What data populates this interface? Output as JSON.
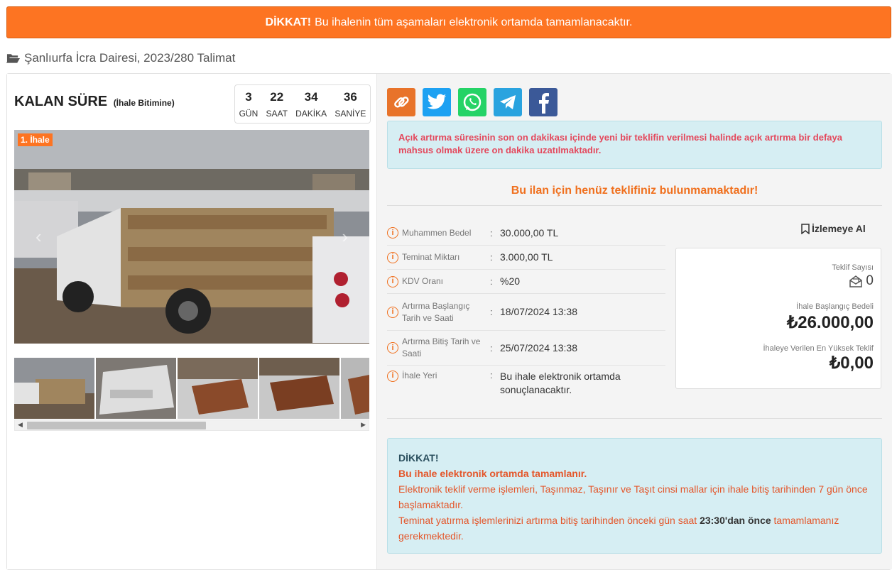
{
  "banner": {
    "strong": "DİKKAT!",
    "text": "Bu ihalenin tüm aşamaları elektronik ortamda tamamlanacaktır."
  },
  "breadcrumb": {
    "icon": "folder-open-icon",
    "text": "Şanlıurfa İcra Dairesi, 2023/280 Talimat"
  },
  "countdown": {
    "title": "KALAN SÜRE",
    "subtitle": "(İhale Bitimine)",
    "days": "3",
    "days_label": "GÜN",
    "hours": "22",
    "hours_label": "SAAT",
    "minutes": "34",
    "minutes_label": "DAKİKA",
    "seconds": "36",
    "seconds_label": "SANİYE"
  },
  "gallery": {
    "badge": "1. İhale",
    "thumb_count": 5
  },
  "share": {
    "icons": [
      "link-icon",
      "twitter-icon",
      "whatsapp-icon",
      "telegram-icon",
      "facebook-icon"
    ],
    "colors": {
      "link": "#e8732a",
      "twitter": "#1da1f2",
      "whatsapp": "#25d366",
      "telegram": "#2aa3df",
      "facebook": "#3b5998"
    }
  },
  "alert": {
    "text": "Açık artırma süresinin son on dakikası içinde yeni bir teklifin verilmesi halinde açık artırma bir defaya mahsus olmak üzere on dakika uzatılmaktadır."
  },
  "no_bid": "Bu ilan için henüz teklifiniz bulunmamaktadır!",
  "details": [
    {
      "label": "Muhammen Bedel",
      "value": "30.000,00 TL"
    },
    {
      "label": "Teminat Miktarı",
      "value": "3.000,00 TL"
    },
    {
      "label": "KDV Oranı",
      "value": "%20"
    },
    {
      "label": "Artırma Başlangıç Tarih ve Saati",
      "value": "18/07/2024 13:38"
    },
    {
      "label": "Artırma Bitiş Tarih ve Saati",
      "value": "25/07/2024 13:38"
    },
    {
      "label": "İhale Yeri",
      "value": "Bu ihale elektronik ortamda sonuçlanacaktır."
    }
  ],
  "watch": {
    "label": "İzlemeye Al"
  },
  "summary": {
    "bid_count_label": "Teklif Sayısı",
    "bid_count": "0",
    "start_price_label": "İhale Başlangıç Bedeli",
    "start_price": "₺26.000,00",
    "highest_label": "İhaleye Verilen En Yüksek Teklif",
    "highest": "₺0,00"
  },
  "notice": {
    "title": "DİKKAT!",
    "bold_line": "Bu ihale elektronik ortamda tamamlanır.",
    "line1": "Elektronik teklif verme işlemleri, Taşınmaz, Taşınır ve Taşıt cinsi mallar için ihale bitiş tarihinden 7 gün önce başlamaktadır.",
    "line2_pre": "Teminat yatırma işlemlerinizi artırma bitiş tarihinden önceki gün saat ",
    "line2_bold": "23:30'dan önce",
    "line2_post": " tamamlamanız gerekmektedir."
  }
}
